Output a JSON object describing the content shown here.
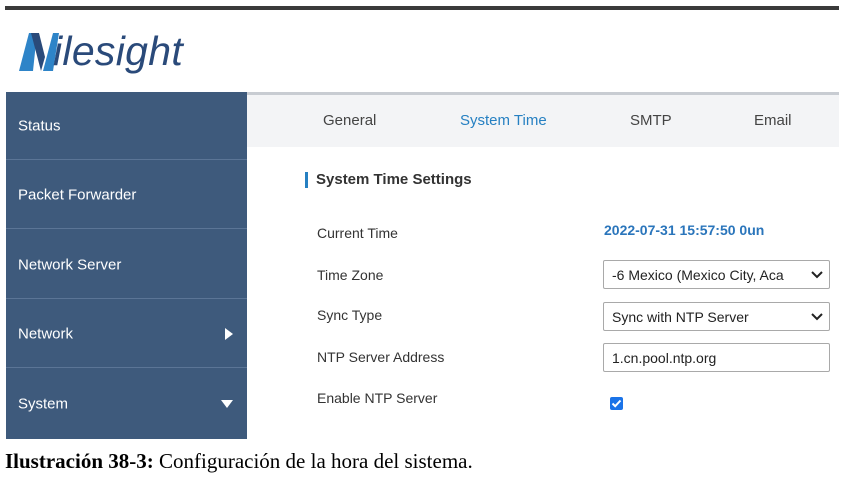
{
  "brand": {
    "logo_text": "ilesight",
    "logo_initial": "M",
    "colors": {
      "blue": "#2e84c8",
      "dark": "#2a4a7a"
    }
  },
  "sidebar": {
    "items": [
      {
        "label": "Status",
        "icon": ""
      },
      {
        "label": "Packet Forwarder",
        "icon": ""
      },
      {
        "label": "Network Server",
        "icon": ""
      },
      {
        "label": "Network",
        "icon": "triangle-right-icon"
      },
      {
        "label": "System",
        "icon": "triangle-down-icon"
      }
    ],
    "background": "#3e5a7c"
  },
  "tabs": [
    {
      "label": "General",
      "active": false
    },
    {
      "label": "System Time",
      "active": true
    },
    {
      "label": "SMTP",
      "active": false
    },
    {
      "label": "Email",
      "active": false
    }
  ],
  "settings": {
    "section_title": "System Time Settings",
    "current_time_label": "Current Time",
    "current_time_value": "2022-07-31 15:57:50 0un",
    "time_zone_label": "Time Zone",
    "time_zone_value": "-6 Mexico (Mexico City, Aca",
    "sync_type_label": "Sync Type",
    "sync_type_value": "Sync with NTP Server",
    "ntp_address_label": "NTP Server Address",
    "ntp_address_value": "1.cn.pool.ntp.org",
    "enable_ntp_label": "Enable NTP Server",
    "enable_ntp_checked": true
  },
  "caption": {
    "prefix": "Ilustración 38-3:",
    "text": " Configuración de la hora del sistema."
  }
}
